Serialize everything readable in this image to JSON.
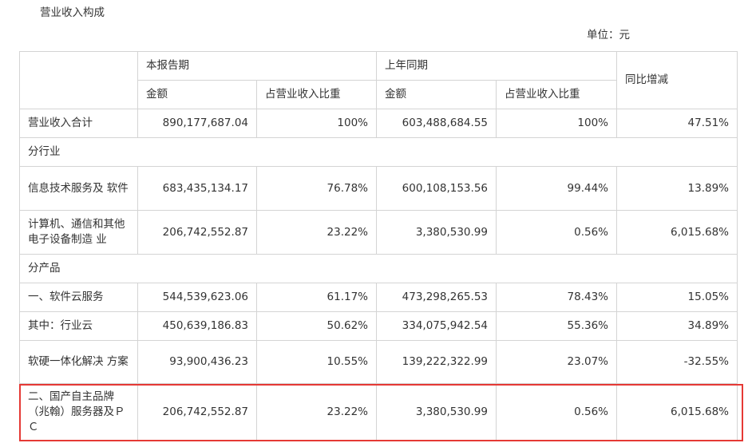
{
  "heading": "营业收入构成",
  "unit_label": "单位：元",
  "table": {
    "header": {
      "current_period": "本报告期",
      "prior_period": "上年同期",
      "yoy_change": "同比增减",
      "amount": "金额",
      "share": "占营业收入比重"
    },
    "rows": [
      {
        "label": "营业收入合计",
        "cur_amount": "890,177,687.04",
        "cur_share": "100%",
        "prev_amount": "603,488,684.55",
        "prev_share": "100%",
        "yoy": "47.51%"
      },
      {
        "label": "分行业"
      },
      {
        "label": "信息技术服务及 软件",
        "cur_amount": "683,435,134.17",
        "cur_share": "76.78%",
        "prev_amount": "600,108,153.56",
        "prev_share": "99.44%",
        "yoy": "13.89%"
      },
      {
        "label": "计算机、通信和其他电子设备制造 业",
        "cur_amount": "206,742,552.87",
        "cur_share": "23.22%",
        "prev_amount": "3,380,530.99",
        "prev_share": "0.56%",
        "yoy": "6,015.68%"
      },
      {
        "label": "分产品"
      },
      {
        "label": "一、软件云服务",
        "cur_amount": "544,539,623.06",
        "cur_share": "61.17%",
        "prev_amount": "473,298,265.53",
        "prev_share": "78.43%",
        "yoy": "15.05%"
      },
      {
        "label": "其中：行业云",
        "cur_amount": "450,639,186.83",
        "cur_share": "50.62%",
        "prev_amount": "334,075,942.54",
        "prev_share": "55.36%",
        "yoy": "34.89%"
      },
      {
        "label": "软硬一体化解决 方案",
        "cur_amount": "93,900,436.23",
        "cur_share": "10.55%",
        "prev_amount": "139,222,322.99",
        "prev_share": "23.07%",
        "yoy": "-32.55%"
      },
      {
        "label": "二、国产自主品牌（兆翰）服务器及ＰＣ",
        "cur_amount": "206,742,552.87",
        "cur_share": "23.22%",
        "prev_amount": "3,380,530.99",
        "prev_share": "0.56%",
        "yoy": "6,015.68%"
      }
    ]
  },
  "colors": {
    "highlight_border": "#e53935",
    "grid": "#d4d4d4",
    "text": "#333333"
  }
}
